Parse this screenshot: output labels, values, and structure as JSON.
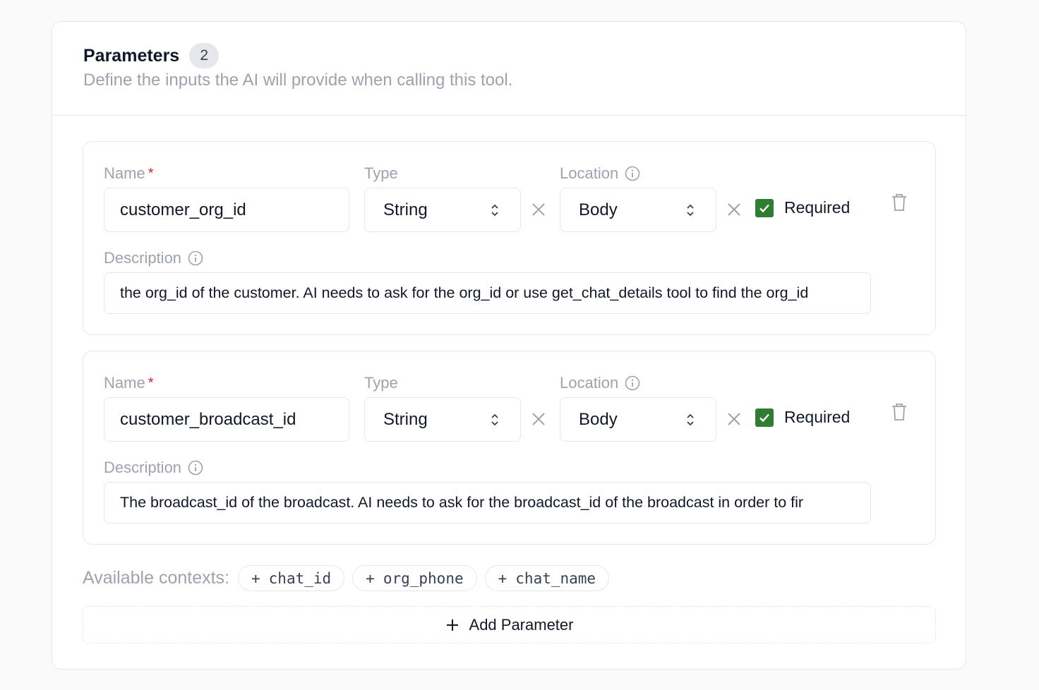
{
  "header": {
    "title": "Parameters",
    "count": "2",
    "subtitle": "Define the inputs the AI will provide when calling this tool."
  },
  "labels": {
    "name": "Name",
    "required_star": "*",
    "type": "Type",
    "location": "Location",
    "description": "Description",
    "required": "Required"
  },
  "parameters": [
    {
      "name": "customer_org_id",
      "type": "String",
      "location": "Body",
      "required": true,
      "description": "the org_id of the customer. AI needs to ask for the org_id or use get_chat_details tool to find the org_id"
    },
    {
      "name": "customer_broadcast_id",
      "type": "String",
      "location": "Body",
      "required": true,
      "description": "The broadcast_id of the broadcast. AI needs to ask for the broadcast_id of the broadcast in order to fir"
    }
  ],
  "contexts": {
    "label": "Available contexts:",
    "chip_prefix": "+",
    "items": [
      "chat_id",
      "org_phone",
      "chat_name"
    ]
  },
  "add_button": {
    "label": "Add Parameter"
  },
  "colors": {
    "checkbox": "#2e7d32",
    "required_star": "#dc2626",
    "muted_text": "#9ca3af",
    "border": "#e5e7eb"
  }
}
